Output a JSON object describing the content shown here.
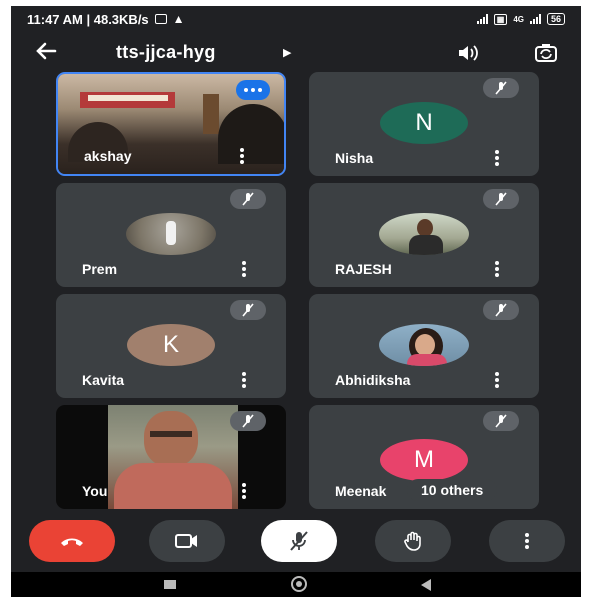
{
  "status": {
    "time_speed": "11:47 AM | 48.3KB/s",
    "net_label": "4G",
    "battery": "56"
  },
  "header": {
    "meeting_code": "tts-jjca-hyg"
  },
  "participants": [
    {
      "name": "akshay",
      "type": "video"
    },
    {
      "name": "Nisha",
      "type": "initial",
      "initial": "N",
      "color": "#1e6b57"
    },
    {
      "name": "Prem",
      "type": "photo"
    },
    {
      "name": "RAJESH",
      "type": "photo"
    },
    {
      "name": "Kavita",
      "type": "initial",
      "initial": "K",
      "color": "#a1806d"
    },
    {
      "name": "Abhidiksha",
      "type": "photo"
    },
    {
      "name": "You",
      "type": "video"
    },
    {
      "name": "Meenak",
      "type": "initial",
      "initial": "M",
      "color": "#e8436b"
    }
  ],
  "others_chip": "10 others",
  "colors": {
    "background": "#202124",
    "tile": "#3c4043",
    "end_call": "#ea4335",
    "speaking_border": "#4285f4"
  },
  "icons": {
    "back": "arrow-left-icon",
    "speaker": "speaker-icon",
    "camera_switch": "switch-camera-icon",
    "end_call": "phone-hangup-icon",
    "camera": "video-camera-icon",
    "mic": "mic-off-icon",
    "raise_hand": "hand-icon",
    "more": "more-vert-icon"
  }
}
